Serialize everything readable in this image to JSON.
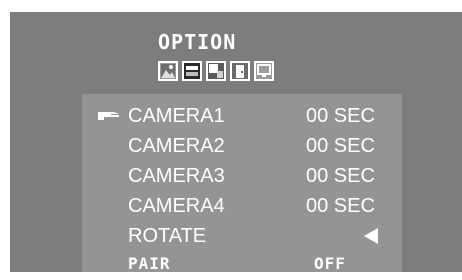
{
  "menu": {
    "title": "OPTION",
    "tabs": [
      {
        "icon": "picture-icon"
      },
      {
        "icon": "film-icon"
      },
      {
        "icon": "image-settings-icon"
      },
      {
        "icon": "door-icon"
      },
      {
        "icon": "monitor-icon"
      }
    ],
    "items": [
      {
        "label": "CAMERA1",
        "value": "00 SEC",
        "selected": true
      },
      {
        "label": "CAMERA2",
        "value": "00 SEC"
      },
      {
        "label": "CAMERA3",
        "value": "00 SEC"
      },
      {
        "label": "CAMERA4",
        "value": "00 SEC"
      },
      {
        "label": "ROTATE",
        "value_icon": "left-triangle-icon"
      },
      {
        "label": "PAIR",
        "value": "OFF"
      }
    ]
  },
  "colors": {
    "screen_bg": "#7d7d7d",
    "panel_bg": "#949494",
    "text": "#ffffff"
  }
}
